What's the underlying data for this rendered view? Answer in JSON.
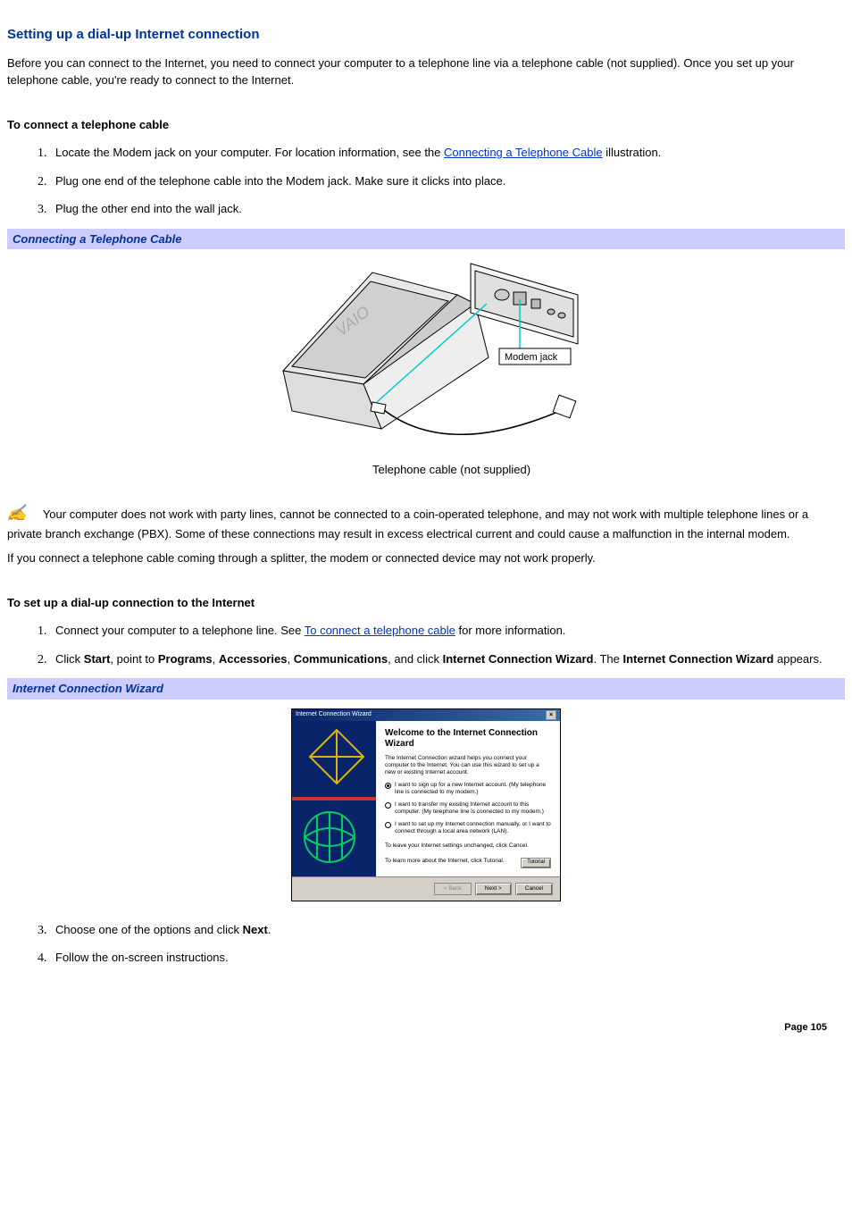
{
  "heading": "Setting up a dial-up Internet connection",
  "intro": "Before you can connect to the Internet, you need to connect your computer to a telephone line via a telephone cable (not supplied). Once you set up your telephone cable, you're ready to connect to the Internet.",
  "section1_title": "To connect a telephone cable",
  "s1_item1_pre": "Locate the Modem jack on your computer. For location information, see the ",
  "s1_item1_link": "Connecting a Telephone Cable",
  "s1_item1_post": " illustration.",
  "s1_item2": "Plug one end of the telephone cable into the Modem jack. Make sure it clicks into place.",
  "s1_item3": "Plug the other end into the wall jack.",
  "figure1_caption": "Connecting a Telephone Cable",
  "fig1_label_modem": "Modem jack",
  "fig1_label_cable": "Telephone cable (not supplied)",
  "note_text": "Your computer does not work with party lines, cannot be connected to a coin-operated telephone, and may not work with multiple telephone lines or a private branch exchange (PBX). Some of these connections may result in excess electrical current and could cause a malfunction in the internal modem.",
  "note_followup": "If you connect a telephone cable coming through a splitter, the modem or connected device may not work properly.",
  "section2_title": "To set up a dial-up connection to the Internet",
  "s2_item1_pre": "Connect your computer to a telephone line. See ",
  "s2_item1_link": "To connect a telephone cable",
  "s2_item1_post": " for more information.",
  "s2_item2_click": "Click ",
  "s2_item2_start": "Start",
  "s2_item2_t1": ", point to ",
  "s2_item2_programs": "Programs",
  "s2_item2_t2": ", ",
  "s2_item2_accessories": "Accessories",
  "s2_item2_t3": ", ",
  "s2_item2_comm": "Communications",
  "s2_item2_t4": ", and click ",
  "s2_item2_icw": "Internet Connection Wizard",
  "s2_item2_t5": ". The ",
  "s2_item2_icw2": "Internet Connection Wizard",
  "s2_item2_t6": " appears.",
  "figure2_caption": "Internet Connection Wizard",
  "wizard": {
    "titlebar": "Internet Connection Wizard",
    "title": "Welcome to the Internet Connection Wizard",
    "intro": "The Internet Connection wizard helps you connect your computer to the Internet. You can use this wizard to set up a new or existing Internet account.",
    "opt1": "I want to sign up for a new Internet account. (My telephone line is connected to my modem.)",
    "opt2": "I want to transfer my existing Internet account to this computer. (My telephone line is connected to my modem.)",
    "opt3": "I want to set up my Internet connection manually, or I want to connect through a local area network (LAN).",
    "leave": "To leave your Internet settings unchanged, click Cancel.",
    "learn": "To learn more about the Internet, click Tutorial.",
    "tutorial_btn": "Tutorial",
    "back": "< Back",
    "next": "Next >",
    "cancel": "Cancel"
  },
  "s2_item3_pre": "Choose one of the options and click ",
  "s2_item3_bold": "Next",
  "s2_item3_post": ".",
  "s2_item4": "Follow the on-screen instructions.",
  "page_label": "Page 105"
}
